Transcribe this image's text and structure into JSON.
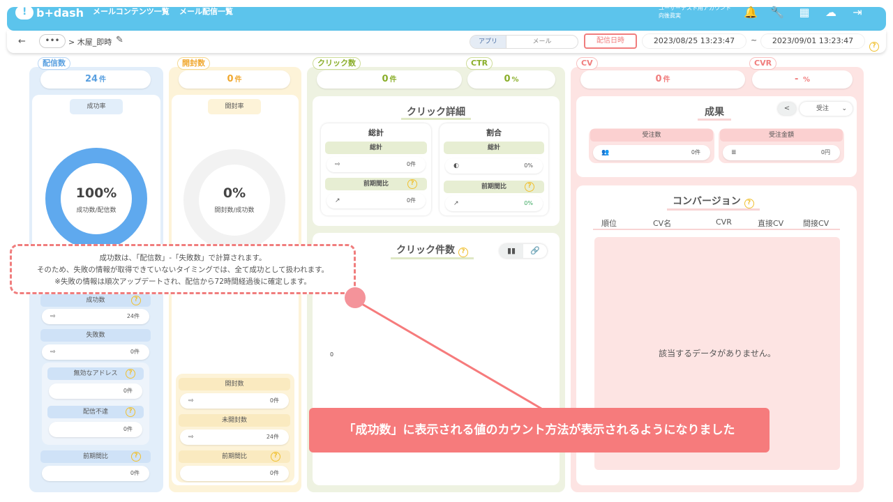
{
  "header": {
    "logo": "b+dash",
    "nav": [
      "メールコンテンツ一覧",
      "メール配信一覧"
    ],
    "account_line1": "ユーザーテスト用アカウント",
    "account_line2": "向後眞実"
  },
  "subbar": {
    "back": "←",
    "more": "•••",
    "breadcrumb": "> 木屋_即時",
    "toggle_app": "アプリ",
    "toggle_mail": "メール",
    "send_date_button": "配信日時",
    "date_from": "2023/08/25 13:23:47",
    "tilde": "~",
    "date_to": "2023/09/01 13:23:47"
  },
  "delivery": {
    "tab": "配信数",
    "count": "24",
    "unit": "件",
    "rate_label": "成功率",
    "percent": "100%",
    "sub": "成功数/配信数",
    "success_label": "成功数",
    "success_val": "24件",
    "fail_label": "失敗数",
    "fail_val": "0件",
    "invalid_label": "無効なアドレス",
    "invalid_val": "0件",
    "undeliv_label": "配信不達",
    "undeliv_val": "0件",
    "prev_label": "前期間比",
    "prev_val": "0件"
  },
  "open": {
    "tab": "開封数",
    "count": "0",
    "unit": "件",
    "rate_label": "開封率",
    "percent": "0%",
    "sub": "開封数/成功数",
    "opened_label": "開封数",
    "opened_val": "0件",
    "unopened_label": "未開封数",
    "unopened_val": "24件",
    "prev_label": "前期間比",
    "prev_val": "0件"
  },
  "click": {
    "tab": "クリック数",
    "count": "0",
    "unit": "件",
    "ctr_tab": "CTR",
    "ctr": "0",
    "ctr_unit": "%",
    "detail_title": "クリック詳細",
    "total_title": "総計",
    "total_lbl": "総計",
    "total_val": "0件",
    "total_prev_lbl": "前期間比",
    "total_prev_val": "0件",
    "ratio_title": "割合",
    "ratio_lbl": "総計",
    "ratio_val": "0%",
    "ratio_prev_lbl": "前期間比",
    "ratio_prev_val": "0%",
    "count_title": "クリック件数",
    "axis_zero": "0"
  },
  "cv": {
    "tab": "CV",
    "count": "0",
    "unit": "件",
    "cvr_tab": "CVR",
    "cvr": "-",
    "cvr_unit": "%",
    "result_title": "成果",
    "select": "受注",
    "orders_lbl": "受注数",
    "orders_val": "0件",
    "amount_lbl": "受注金額",
    "amount_val": "0円",
    "conv_title": "コンバージョン",
    "cols": [
      "順位",
      "CV名",
      "CVR",
      "直接CV",
      "間接CV"
    ],
    "empty": "該当するデータがありません。"
  },
  "tooltip": {
    "line1": "成功数は、「配信数」-「失敗数」で計算されます。",
    "line2": "そのため、失敗の情報が取得できていないタイミングでは、全て成功として扱われます。",
    "line3": "※失敗の情報は順次アップデートされ、配信から72時間経過後に確定します。"
  },
  "callout": "「成功数」に表示される値のカウント方法が表示されるようになりました",
  "colors": {
    "header": "#5cc4ec",
    "blue": "#e2eefa",
    "yellow": "#fdf3d8",
    "green": "#eef2e1",
    "pink": "#fde4e3",
    "accent_red": "#f07d7d"
  }
}
